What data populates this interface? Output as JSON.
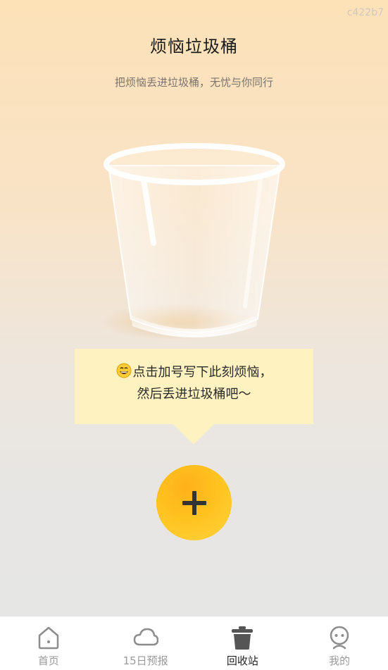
{
  "watermark": "c422b7",
  "header": {
    "title": "烦恼垃圾桶",
    "subtitle": "把烦恼丢进垃圾桶，无忧与你同行"
  },
  "bubble": {
    "emoji": "grinning-face-icon",
    "line1": "点击加号写下此刻烦恼，",
    "line2": "然后丢进垃圾桶吧～"
  },
  "fab": {
    "icon": "plus-icon",
    "color": "#ffb81e"
  },
  "tabs": [
    {
      "label": "首页",
      "icon": "home-icon",
      "active": false
    },
    {
      "label": "15日预报",
      "icon": "cloud-icon",
      "active": false
    },
    {
      "label": "回收站",
      "icon": "trash-icon",
      "active": true
    },
    {
      "label": "我的",
      "icon": "profile-icon",
      "active": false
    }
  ],
  "colors": {
    "accent": "#ffb81e",
    "bubble": "#fef2c0",
    "tab_active": "#222222",
    "tab_inactive": "#9a9a9a"
  }
}
